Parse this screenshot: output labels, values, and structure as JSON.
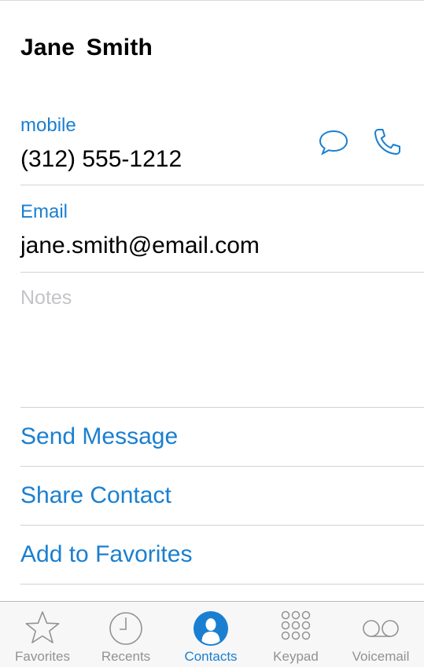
{
  "contact": {
    "name": "Jane  Smith",
    "phone_label": "mobile",
    "phone": "(312) 555-1212",
    "email_label": "Email",
    "email": "jane.smith@email.com",
    "notes_placeholder": "Notes"
  },
  "actions": {
    "send_message": "Send Message",
    "share_contact": "Share Contact",
    "add_favorites": "Add to Favorites"
  },
  "tabbar": {
    "favorites": "Favorites",
    "recents": "Recents",
    "contacts": "Contacts",
    "keypad": "Keypad",
    "voicemail": "Voicemail",
    "active": "contacts"
  },
  "colors": {
    "accent": "#1a7fd0",
    "inactive": "#929292",
    "placeholder": "#c4c4c8"
  },
  "icons": [
    "message-icon",
    "phone-icon",
    "star-icon",
    "clock-icon",
    "person-icon",
    "keypad-icon",
    "voicemail-icon"
  ]
}
